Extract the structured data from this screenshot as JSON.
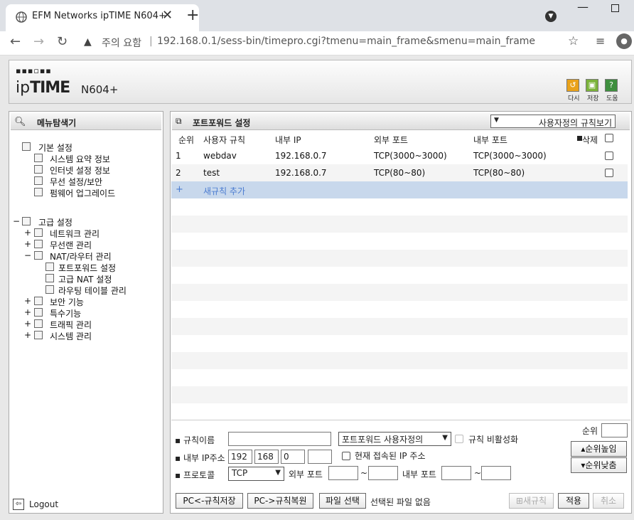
{
  "browser": {
    "tab_title": "EFM Networks ipTIME N604+",
    "security_label": "주의 요함",
    "url": "192.168.0.1/sess-bin/timepro.cgi?tmenu=main_frame&smenu=main_frame"
  },
  "header": {
    "logo": "ipTIME",
    "model": "N604+",
    "actions": [
      {
        "label": "다시",
        "icon": "refresh-icon",
        "color": "#e9a21b"
      },
      {
        "label": "저장",
        "icon": "save-icon",
        "color": "#7bb33a"
      },
      {
        "label": "도움",
        "icon": "help-icon",
        "color": "#3e8f3e"
      }
    ]
  },
  "sidebar": {
    "title": "메뉴탐색기",
    "basic": {
      "label": "기본 설정",
      "items": [
        "시스템 요약 정보",
        "인터넷 설정 정보",
        "무선 설정/보안",
        "펌웨어 업그레이드"
      ]
    },
    "advanced": {
      "label": "고급 설정",
      "items": [
        "네트워크 관리",
        "무선랜 관리",
        "NAT/라우터 관리",
        "보안 기능",
        "특수기능",
        "트래픽 관리",
        "시스템 관리"
      ],
      "nat_children": [
        "포트포워드 설정",
        "고급 NAT 설정",
        "라우팅 테이블 관리"
      ]
    },
    "logout": "Logout"
  },
  "main": {
    "title": "포트포워드 설정",
    "view_select": "사용자정의 규칙보기",
    "columns": [
      "순위",
      "사용자 규칙",
      "내부 IP",
      "외부 포트",
      "내부 포트",
      "삭제"
    ],
    "rows": [
      {
        "rank": "1",
        "rule": "webdav",
        "ip": "192.168.0.7",
        "ext": "TCP(3000~3000)",
        "int": "TCP(3000~3000)"
      },
      {
        "rank": "2",
        "rule": "test",
        "ip": "192.168.0.7",
        "ext": "TCP(80~80)",
        "int": "TCP(80~80)"
      }
    ],
    "add_plus": "+",
    "add_label": "새규칙 추가"
  },
  "form": {
    "rule_name_label": "규칙이름",
    "rule_name_value": "",
    "rule_type_select": "포트포워드 사용자정의",
    "disable_label": "규칙 비활성화",
    "ip_label": "내부 IP주소",
    "ip1": "192",
    "ip2": "168",
    "ip3": "0",
    "ip4": "",
    "current_ip_label": "현재 접속된 IP 주소",
    "protocol_label": "프로토콜",
    "protocol_select": "TCP",
    "ext_port_label": "외부 포트",
    "int_port_label": "내부 포트",
    "tilde": "~",
    "rank_label": "순위",
    "rank_value": "",
    "rank_up": "순위높임",
    "rank_down": "순위낮춤",
    "pc_save": "PC<-규칙저장",
    "pc_restore": "PC->규칙복원",
    "file_select": "파일 선택",
    "no_file": "선택된 파일 없음",
    "new_rule": "새규칙",
    "apply": "적용",
    "cancel": "취소"
  }
}
